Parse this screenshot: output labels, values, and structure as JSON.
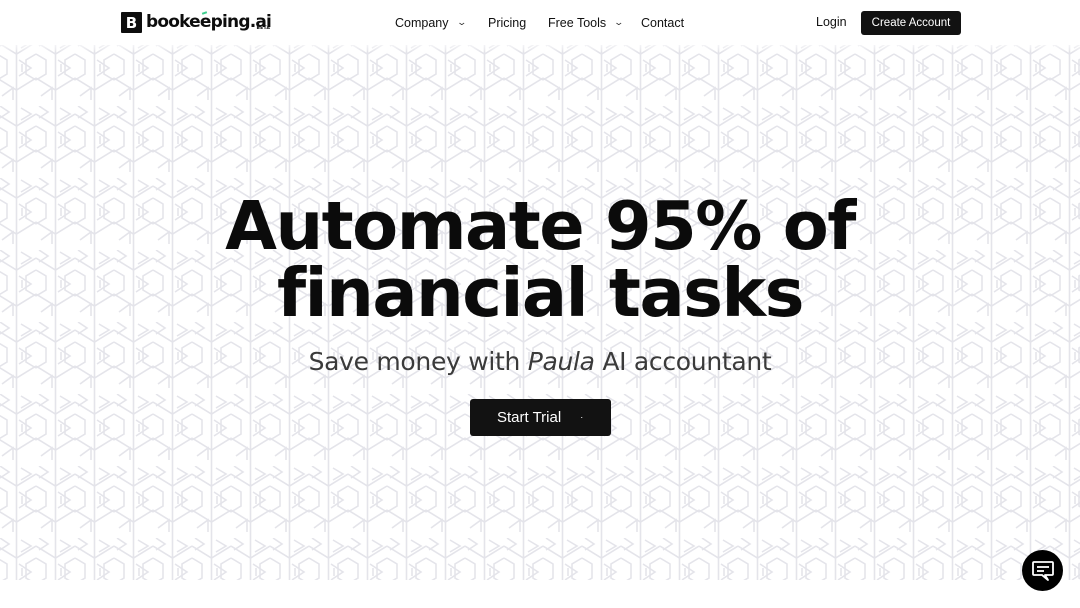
{
  "header": {
    "logo": {
      "mark": "B",
      "text": "bookeeping.ai",
      "badge": "BETA",
      "accent_color": "#3ccf8e"
    },
    "nav": [
      {
        "label": "Company",
        "has_dropdown": true
      },
      {
        "label": "Pricing",
        "has_dropdown": false
      },
      {
        "label": "Free Tools",
        "has_dropdown": true
      },
      {
        "label": "Contact",
        "has_dropdown": false
      }
    ],
    "login_label": "Login",
    "create_account_label": "Create Account",
    "dropdown_icon": "chevron-down-icon"
  },
  "hero": {
    "headline_line1": "Automate 95% of",
    "headline_line2": "financial tasks",
    "subline_before": "Save money with ",
    "subline_emphasis": "Paula",
    "subline_after": " AI accountant",
    "cta_label": "Start Trial",
    "cta_trailing": "·"
  },
  "chat_widget": {
    "icon": "chat-message-icon"
  },
  "colors": {
    "primary_dark": "#121212",
    "pattern_stroke": "#e6e6ec",
    "background": "#ffffff",
    "text": "#0b0b0b",
    "subtext": "#3a3a3a"
  }
}
